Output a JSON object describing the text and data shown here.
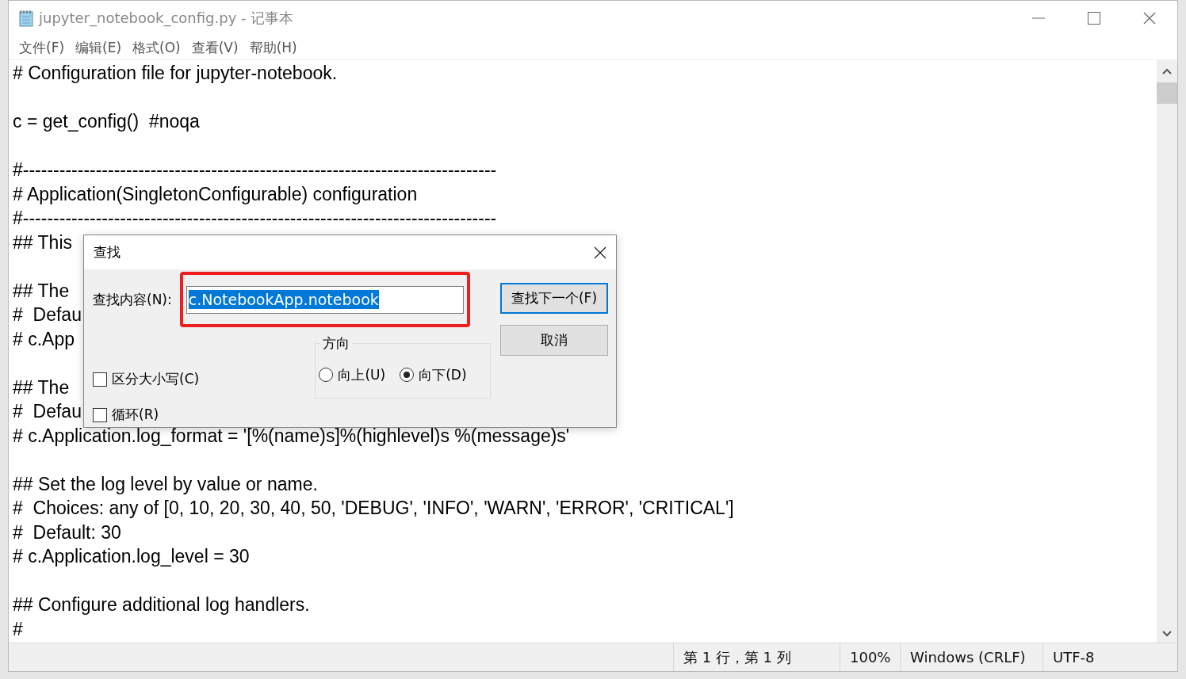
{
  "window": {
    "title": "jupyter_notebook_config.py - 记事本"
  },
  "menu": [
    "文件(F)",
    "编辑(E)",
    "格式(O)",
    "查看(V)",
    "帮助(H)"
  ],
  "editor": {
    "blocks": [
      [
        "# Configuration file for jupyter-notebook."
      ],
      [
        "c = get_config()  #noqa"
      ],
      [
        "#------------------------------------------------------------------------------",
        "# Application(SingletonConfigurable) configuration",
        "#------------------------------------------------------------------------------",
        "## This"
      ],
      [
        "## The",
        "#  Defau",
        "# c.App"
      ],
      [
        "## The",
        "#  Defau",
        "# c.Application.log_format = '[%(name)s]%(highlevel)s %(message)s'"
      ],
      [
        "## Set the log level by value or name.",
        "#  Choices: any of [0, 10, 20, 30, 40, 50, 'DEBUG', 'INFO', 'WARN', 'ERROR', 'CRITICAL']",
        "#  Default: 30",
        "# c.Application.log_level = 30"
      ],
      [
        "## Configure additional log handlers.",
        "#"
      ]
    ]
  },
  "find_dialog": {
    "title": "查找",
    "find_label": "查找内容(N):",
    "find_value": "c.NotebookApp.notebook",
    "find_next_button": "查找下一个(F)",
    "cancel_button": "取消",
    "direction_label": "方向",
    "directions": [
      {
        "label": "向上(U)",
        "selected": false
      },
      {
        "label": "向下(D)",
        "selected": true
      }
    ],
    "options": [
      {
        "label": "区分大小写(C)",
        "checked": false
      },
      {
        "label": "循环(R)",
        "checked": false
      }
    ]
  },
  "status_bar": [
    "第 1 行，第 1 列",
    "100%",
    "Windows (CRLF)",
    "UTF-8"
  ]
}
